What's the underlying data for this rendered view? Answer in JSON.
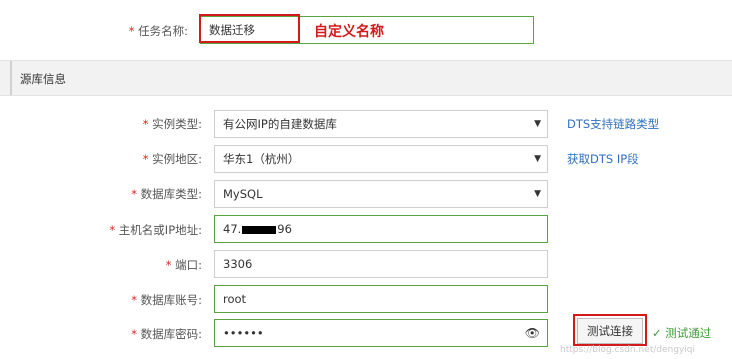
{
  "task": {
    "label": "任务名称:",
    "value": "数据迁移",
    "annotation": "自定义名称"
  },
  "section": {
    "title": "源库信息"
  },
  "fields": {
    "instance_type": {
      "label": "实例类型:",
      "value": "有公网IP的自建数据库",
      "link": "DTS支持链路类型"
    },
    "region": {
      "label": "实例地区:",
      "value": "华东1（杭州）",
      "link": "获取DTS IP段"
    },
    "db_type": {
      "label": "数据库类型:",
      "value": "MySQL"
    },
    "host": {
      "label": "主机名或IP地址:",
      "value_prefix": "47.",
      "value_suffix": "96"
    },
    "port": {
      "label": "端口:",
      "value": "3306"
    },
    "account": {
      "label": "数据库账号:",
      "value": "root"
    },
    "password": {
      "label": "数据库密码:",
      "value": "••••••"
    }
  },
  "required_mark": "*",
  "test_button": {
    "label": "测试连接"
  },
  "test_status": {
    "text": "测试通过",
    "color": "#3e9b35"
  },
  "watermark": "https://blog.csdn.net/dengyiqi",
  "colors": {
    "accent_red": "#d21a1a",
    "valid_green": "#5aa340",
    "link_blue": "#2f6fbf"
  }
}
